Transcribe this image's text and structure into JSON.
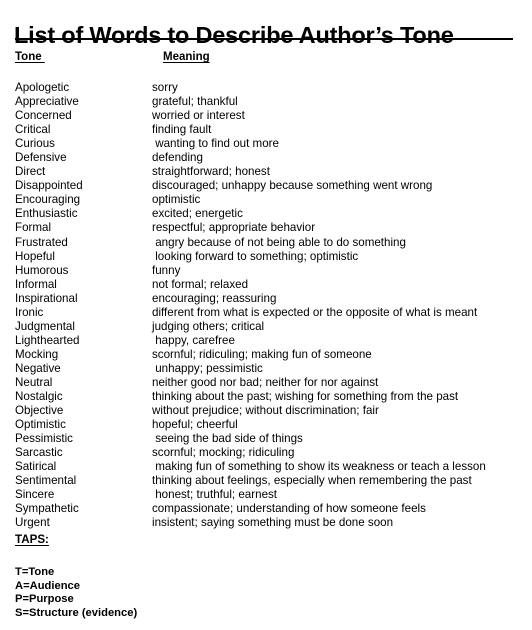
{
  "document": {
    "title": "List of Words to Describe Author’s Tone",
    "background_color": "#ffffff",
    "text_color": "#000000"
  },
  "columns": {
    "tone_header": "Tone ",
    "meaning_header": "Meaning"
  },
  "entries": [
    {
      "tone": "Apologetic",
      "meaning": "sorry"
    },
    {
      "tone": "Appreciative",
      "meaning": "grateful; thankful"
    },
    {
      "tone": "Concerned",
      "meaning": "worried or interest"
    },
    {
      "tone": "Critical",
      "meaning": "finding fault"
    },
    {
      "tone": "Curious",
      "meaning": " wanting to find out more"
    },
    {
      "tone": "Defensive",
      "meaning": "defending"
    },
    {
      "tone": "Direct",
      "meaning": "straightforward; honest"
    },
    {
      "tone": "Disappointed",
      "meaning": "discouraged; unhappy because something went wrong"
    },
    {
      "tone": "Encouraging",
      "meaning": "optimistic"
    },
    {
      "tone": "Enthusiastic",
      "meaning": "excited; energetic"
    },
    {
      "tone": "Formal",
      "meaning": "respectful; appropriate behavior"
    },
    {
      "tone": "Frustrated",
      "meaning": " angry because of not being able to do something"
    },
    {
      "tone": "Hopeful",
      "meaning": " looking forward to something; optimistic"
    },
    {
      "tone": "Humorous",
      "meaning": "funny"
    },
    {
      "tone": "Informal",
      "meaning": "not formal; relaxed"
    },
    {
      "tone": "Inspirational",
      "meaning": "encouraging; reassuring"
    },
    {
      "tone": "Ironic",
      "meaning": "different from what is expected or the opposite of what is meant"
    },
    {
      "tone": "Judgmental",
      "meaning": "judging others; critical"
    },
    {
      "tone": "Lighthearted",
      "meaning": " happy, carefree"
    },
    {
      "tone": "Mocking",
      "meaning": "scornful; ridiculing; making fun of someone"
    },
    {
      "tone": "Negative",
      "meaning": " unhappy; pessimistic"
    },
    {
      "tone": "Neutral",
      "meaning": "neither good nor bad; neither for nor against"
    },
    {
      "tone": "Nostalgic",
      "meaning": "thinking about the past; wishing for something from the past"
    },
    {
      "tone": "Objective",
      "meaning": "without prejudice; without discrimination; fair"
    },
    {
      "tone": "Optimistic",
      "meaning": "hopeful; cheerful"
    },
    {
      "tone": "Pessimistic",
      "meaning": " seeing the bad side of things"
    },
    {
      "tone": "Sarcastic",
      "meaning": "scornful; mocking; ridiculing"
    },
    {
      "tone": "Satirical",
      "meaning": " making fun of something to show its weakness or teach a lesson"
    },
    {
      "tone": "Sentimental",
      "meaning": "thinking about feelings, especially when remembering the past"
    },
    {
      "tone": "Sincere",
      "meaning": " honest; truthful; earnest"
    },
    {
      "tone": "Sympathetic",
      "meaning": "compassionate; understanding of how someone feels"
    },
    {
      "tone": "Urgent",
      "meaning": "insistent; saying something must be done soon"
    }
  ],
  "taps": {
    "heading": "TAPS:",
    "items": [
      "T=Tone",
      "A=Audience",
      "P=Purpose",
      "S=Structure (evidence)"
    ]
  }
}
